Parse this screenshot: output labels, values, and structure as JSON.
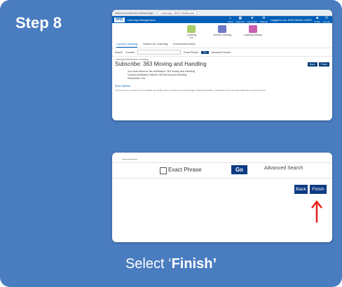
{
  "step": {
    "title": "Step 8"
  },
  "screenshot": {
    "browser": {
      "url": "https://rs.local.nhs.uk/learning/...",
      "tab": "Learning - NHS Healthcare"
    },
    "header": {
      "logo": "NHS",
      "app_name": "Learning Management",
      "nav": [
        {
          "icon": "home-icon",
          "glyph": "⌂",
          "label": "Home"
        },
        {
          "icon": "calendar-icon",
          "glyph": "▦",
          "label": "Calendar"
        },
        {
          "icon": "favourites-icon",
          "glyph": "★",
          "label": "Favourites"
        },
        {
          "icon": "settings-icon",
          "glyph": "⚙",
          "label": "Settings"
        }
      ],
      "user": "Logged in as: ESR.DEMO.USER",
      "right_icons": [
        {
          "icon": "user-icon",
          "glyph": "☻",
          "label": "Profile"
        },
        {
          "icon": "logout-icon",
          "glyph": "⏻",
          "label": "Log out"
        }
      ]
    },
    "tiles": [
      {
        "label": "Learning",
        "sub": "4%",
        "color": "#a8cf6a"
      },
      {
        "label": "Current Learning",
        "sub": "",
        "color": "#6f78c8"
      },
      {
        "label": "Learning History",
        "sub": "",
        "color": "#c85fb0"
      }
    ],
    "tabs": [
      "Current Learning",
      "Search for Learning",
      "Enrolments/Class"
    ],
    "search": {
      "label": "Search",
      "scope": "Courses",
      "go": "Go",
      "advanced": "Advanced Search",
      "exact": "Exact Phrase"
    },
    "crumb": "Learning Self-service Learning",
    "course_title": "Subscribe: 363 Moving and Handling",
    "course_buttons": [
      "Back",
      "Finish"
    ],
    "details": [
      "You must select for the certification:  363 Moving and Handling",
      "Course/certification Valid till:  363 Moving and Handling",
      "Renewable:  Yes"
    ],
    "section": "Show Options",
    "description": "The key focus of a learner is to maintain and update their competency and knowledge of Manual handling. Certification to be renewed within the set period of time."
  },
  "zoom": {
    "exact_phrase_label": "Exact Phrase",
    "go_label": "Go",
    "advanced_search_label": "Advanced Search",
    "back_label": "Back",
    "finish_label": "Finish",
    "arrow_color": "#e8231b"
  },
  "instruction": {
    "prefix": "Select ‘",
    "emphasis": "Finish’"
  },
  "colors": {
    "card_bg": "#4a7cc0",
    "nhs_blue": "#005eb8",
    "button_blue": "#0c3b82"
  }
}
